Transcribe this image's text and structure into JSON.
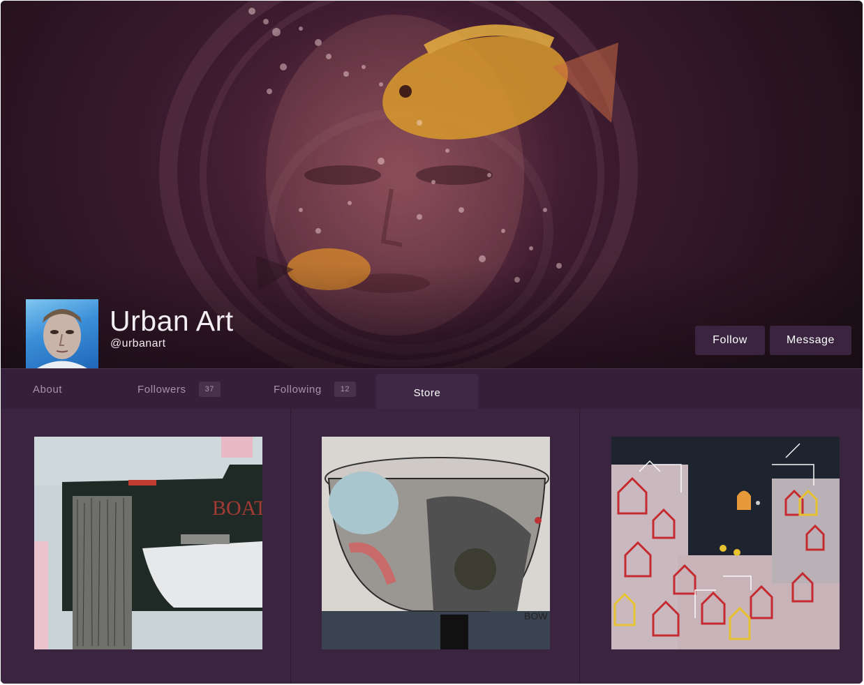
{
  "profile": {
    "name": "Urban Art",
    "handle": "@urbanart",
    "avatar_icon": "user-avatar-portrait",
    "cover_image": "fish-bowl-face-artwork"
  },
  "actions": {
    "follow_label": "Follow",
    "message_label": "Message"
  },
  "tabs": [
    {
      "label": "About"
    },
    {
      "label": "Followers",
      "count": "37"
    },
    {
      "label": "Following",
      "count": "12"
    },
    {
      "label": "Store",
      "active": true
    }
  ],
  "store": {
    "items": [
      {
        "image": "abstract-boat-painting",
        "visible_text": "BOAT"
      },
      {
        "image": "abstract-bowl-painting",
        "visible_text": "BOW"
      },
      {
        "image": "city-houses-painting"
      }
    ]
  },
  "colors": {
    "tab_bar": "#352039",
    "content_bg": "#3b2440",
    "button_bg": "#3a2440",
    "active_tab_text": "#ffffff",
    "inactive_tab_text": "#a894a8"
  }
}
